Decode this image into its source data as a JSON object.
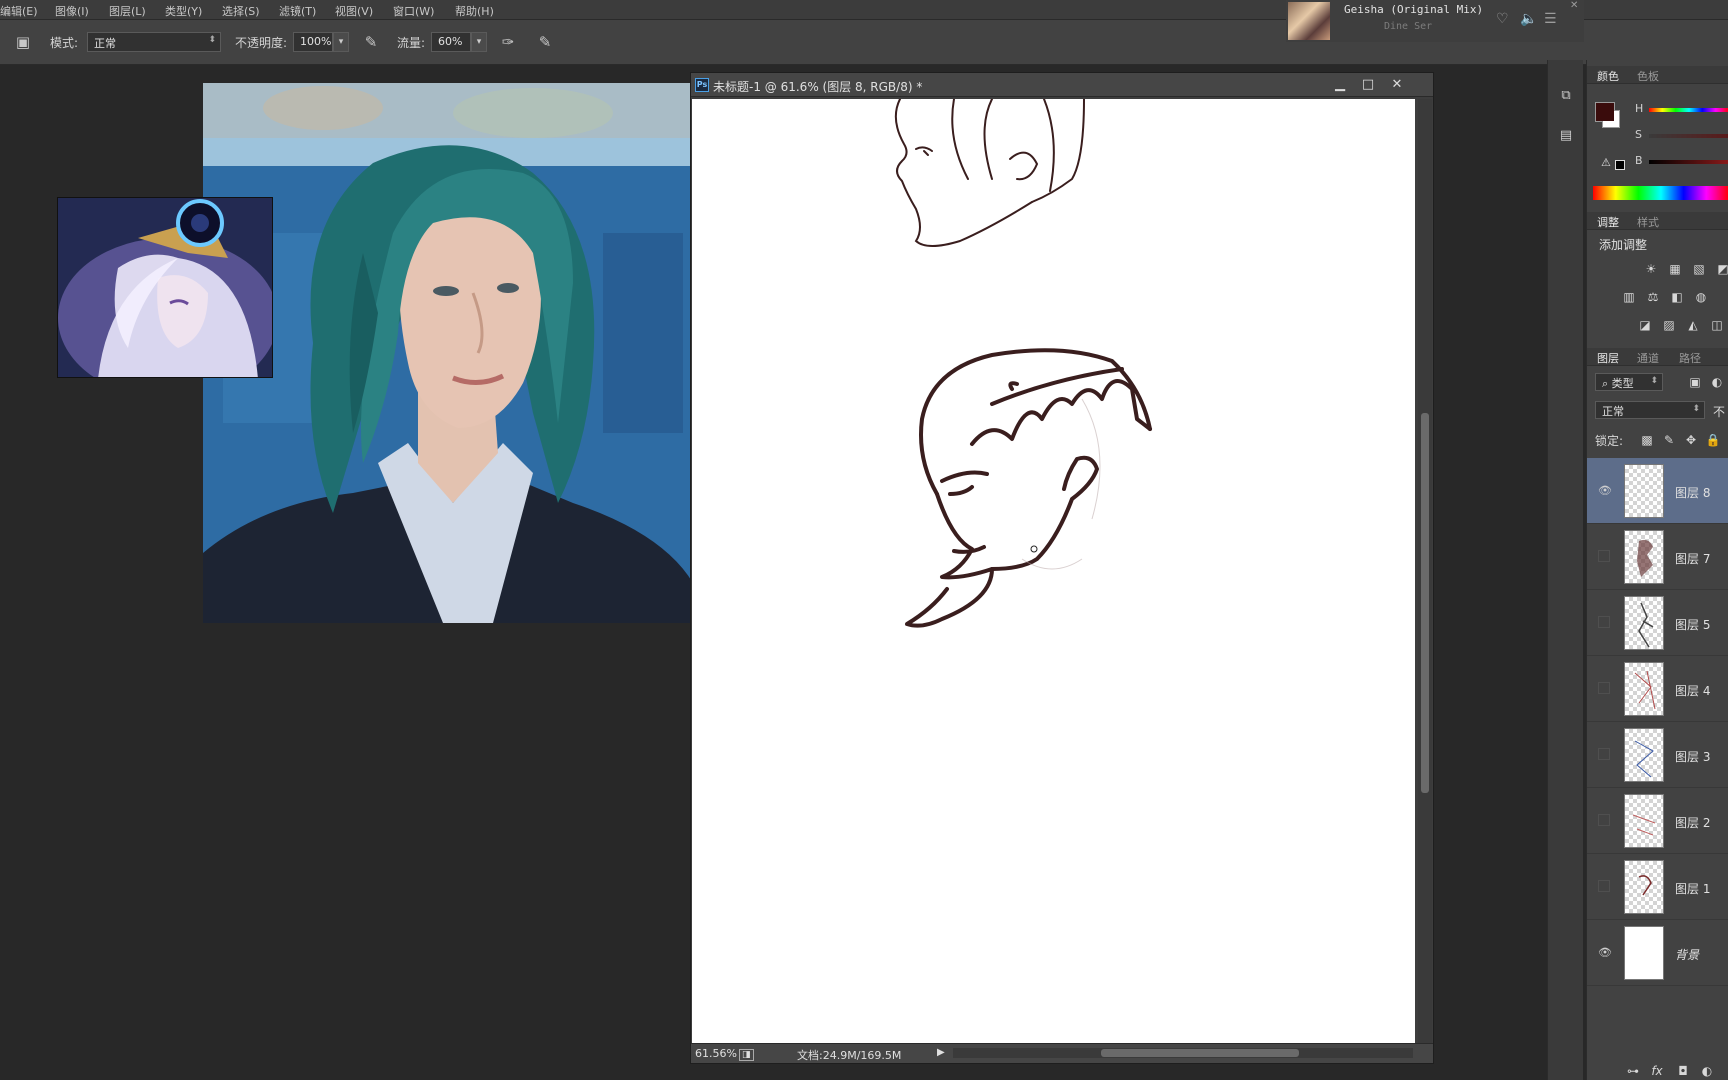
{
  "menubar": {
    "items": [
      "编辑(E)",
      "图像(I)",
      "图层(L)",
      "类型(Y)",
      "选择(S)",
      "滤镜(T)",
      "视图(V)",
      "窗口(W)",
      "帮助(H)"
    ]
  },
  "music": {
    "title": "Geisha (Original Mix)",
    "artist": "Dine Ser",
    "icons": [
      "heart-icon",
      "volume-icon",
      "playlist-icon"
    ]
  },
  "options": {
    "mode_label": "模式:",
    "mode_value": "正常",
    "opacity_label": "不透明度:",
    "opacity_value": "100%",
    "flow_label": "流量:",
    "flow_value": "60%"
  },
  "document": {
    "title": "未标题-1 @ 61.6% (图层 8, RGB/8) *",
    "ps_badge": "Ps",
    "zoom": "61.56%",
    "doc_info": "文档:24.9M/169.5M"
  },
  "color_panel": {
    "tabs": [
      "颜色",
      "色板"
    ],
    "channels": [
      "H",
      "S",
      "B"
    ],
    "foreground_color": "#3a0c0c",
    "background_color": "#ffffff"
  },
  "adjust_panel": {
    "tabs": [
      "调整",
      "样式"
    ],
    "heading": "添加调整"
  },
  "layers_panel": {
    "tabs": [
      "图层",
      "通道",
      "路径"
    ],
    "filter_label": "类型",
    "blend_mode": "正常",
    "opacity_short": "不",
    "lock_label": "锁定:",
    "layers": [
      {
        "name": "图层 8",
        "visible": true,
        "selected": true
      },
      {
        "name": "图层 7",
        "visible": false,
        "selected": false
      },
      {
        "name": "图层 5",
        "visible": false,
        "selected": false
      },
      {
        "name": "图层 4",
        "visible": false,
        "selected": false
      },
      {
        "name": "图层 3",
        "visible": false,
        "selected": false
      },
      {
        "name": "图层 2",
        "visible": false,
        "selected": false
      },
      {
        "name": "图层 1",
        "visible": false,
        "selected": false
      },
      {
        "name": "背景",
        "visible": true,
        "selected": false
      }
    ]
  },
  "colors": {
    "accent_selected": "#5d6d8a",
    "ink": "#3a1e1e"
  }
}
